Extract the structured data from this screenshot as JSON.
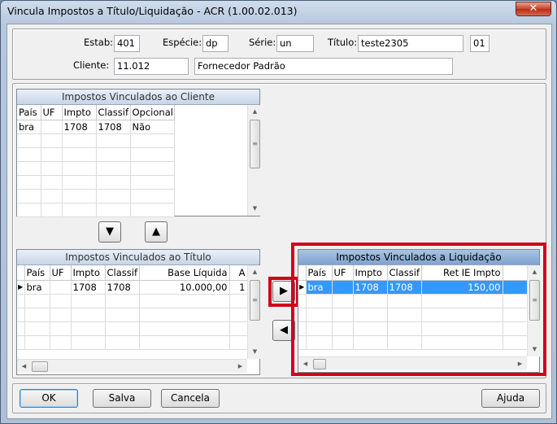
{
  "window": {
    "title": "Vincula Impostos a Título/Liquidação - ACR (1.00.02.013)",
    "close_glyph": "✕"
  },
  "header": {
    "estab_label": "Estab:",
    "estab_value": "401",
    "especie_label": "Espécie:",
    "especie_value": "dp",
    "serie_label": "Série:",
    "serie_value": "un",
    "titulo_label": "Título:",
    "titulo_value": "teste2305",
    "parcela_value": "01",
    "cliente_label": "Cliente:",
    "cliente_value": "11.012",
    "cliente_nome": "Fornecedor Padrão"
  },
  "panel_cliente": {
    "title": "Impostos Vinculados ao Cliente",
    "columns": [
      "País",
      "UF",
      "Impto",
      "Classif",
      "Opcional"
    ],
    "rows": [
      {
        "pais": "bra",
        "uf": "",
        "impto": "1708",
        "classif": "1708",
        "opcional": "Não"
      }
    ]
  },
  "panel_titulo": {
    "title": "Impostos Vinculados ao Título",
    "columns": [
      "País",
      "UF",
      "Impto",
      "Classif",
      "Base Líquida",
      "A"
    ],
    "rows": [
      {
        "pais": "bra",
        "uf": "",
        "impto": "1708",
        "classif": "1708",
        "base": "10.000,00",
        "extra": "1"
      }
    ]
  },
  "panel_liquidacao": {
    "title": "Impostos Vinculados a Liquidação",
    "columns": [
      "País",
      "UF",
      "Impto",
      "Classif",
      "Ret IE Impto"
    ],
    "rows": [
      {
        "pais": "bra",
        "uf": "",
        "impto": "1708",
        "classif": "1708",
        "ret": "150,00"
      }
    ]
  },
  "arrows": {
    "down": "▼",
    "up": "▲",
    "right": "▶",
    "left": "◀"
  },
  "scroll": {
    "up": "▲",
    "down": "▼",
    "left": "◀",
    "right": "▶",
    "grip": "≡",
    "row_marker": "▶"
  },
  "buttons": {
    "ok": "OK",
    "salva": "Salva",
    "cancela": "Cancela",
    "ajuda": "Ajuda"
  },
  "colors": {
    "highlight_border": "#d0021b",
    "selection": "#3399ff"
  }
}
